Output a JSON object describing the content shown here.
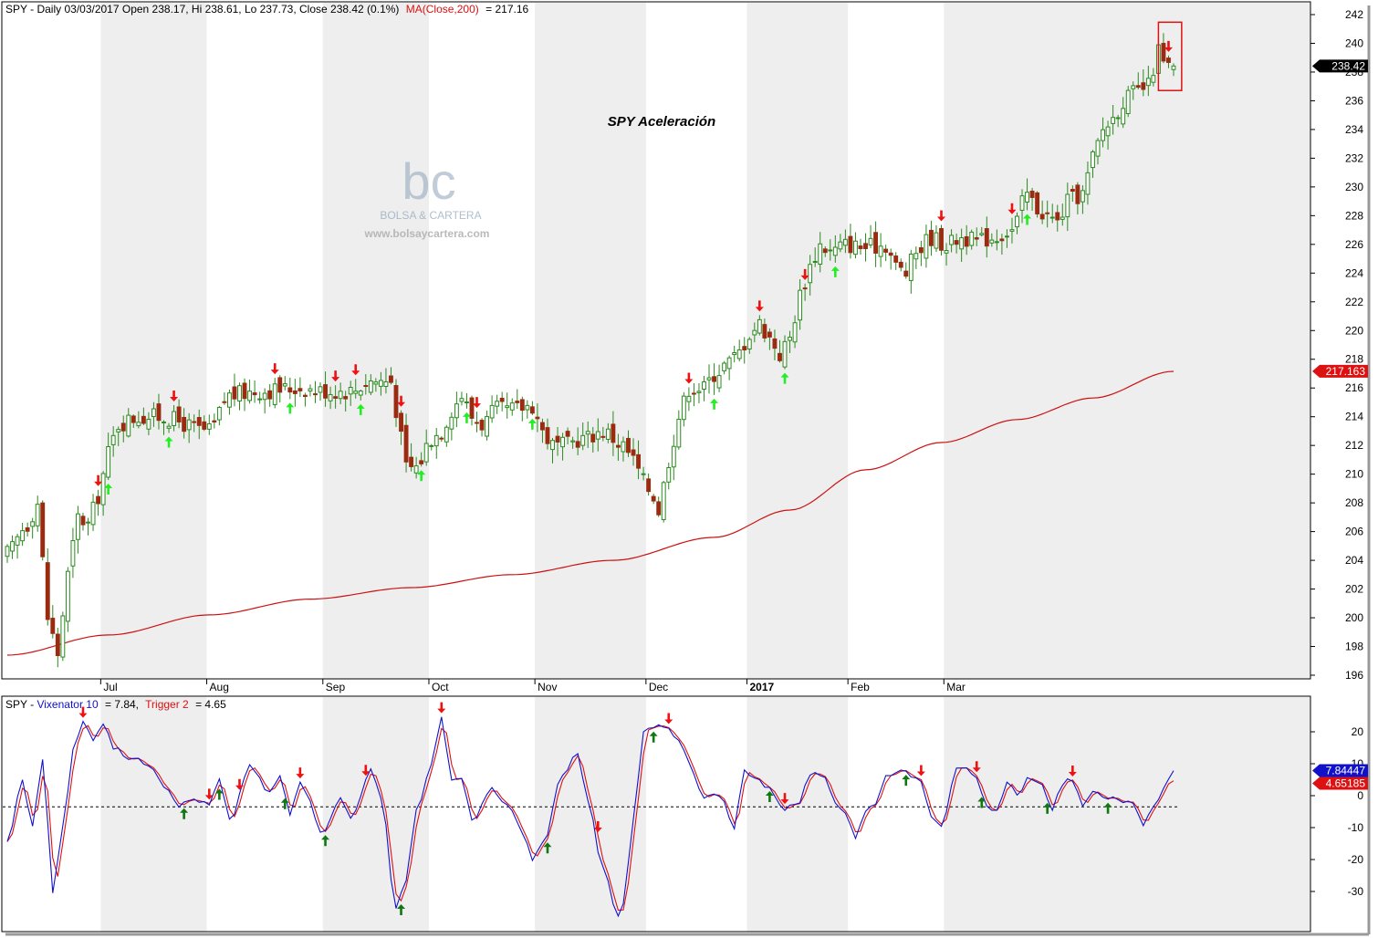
{
  "header": {
    "main_prefix": "SPY - Daily 03/03/2017 Open 238.17, Hi 238.61, Lo 237.73, Close 238.42 (0.1%)",
    "ma_label": "MA(Close,200)",
    "ma_value_text": "= 217.16",
    "ind_prefix": "SPY - ",
    "vix_label": "Vixenator 10",
    "vix_value_text": "= 7.84,",
    "trig_label": "Trigger 2",
    "trig_value_text": "= 4.65"
  },
  "annotation": "SPY Aceleración",
  "watermark": {
    "logo": "bc",
    "name": "BOLSA & CARTERA",
    "url": "www.bolsaycartera.com"
  },
  "colors": {
    "up": "#2a8a1e",
    "down": "#9a2a10",
    "ma": "#cc1111",
    "vix": "#1111cc",
    "trigger": "#dd1111",
    "arrow_up_main": "#22ee22",
    "arrow_up_ind": "#117711",
    "arrow_down": "#ee1111",
    "band": "#eeeeee"
  },
  "price_tags": [
    {
      "label": "238.42",
      "value": 238.42,
      "bg": "#000000",
      "fg": "#ffffff"
    },
    {
      "label": "217.163",
      "value": 217.163,
      "bg": "#dd1111",
      "fg": "#ffffff"
    }
  ],
  "ind_tags": [
    {
      "label": "7.84447",
      "value": 7.84,
      "bg": "#1111cc",
      "fg": "#ffffff"
    },
    {
      "label": "4.65185",
      "value": 4.65,
      "bg": "#dd1111",
      "fg": "#ffffff"
    }
  ],
  "chart_data": [
    {
      "type": "candlestick",
      "title": "SPY - Daily",
      "yticks": [
        196,
        198,
        200,
        202,
        204,
        206,
        208,
        210,
        212,
        214,
        216,
        218,
        220,
        222,
        224,
        226,
        228,
        230,
        232,
        234,
        236,
        238,
        240,
        242
      ],
      "ylim": [
        195,
        243
      ],
      "months": [
        {
          "label": "Jul",
          "bold": false
        },
        {
          "label": "Aug",
          "bold": false
        },
        {
          "label": "Sep",
          "bold": false
        },
        {
          "label": "Oct",
          "bold": false
        },
        {
          "label": "Nov",
          "bold": false
        },
        {
          "label": "Dec",
          "bold": false
        },
        {
          "label": "2017",
          "bold": true
        },
        {
          "label": "Feb",
          "bold": false
        },
        {
          "label": "Mar",
          "bold": false
        }
      ],
      "ma_anchors": [
        [
          0,
          197.4
        ],
        [
          20,
          198.8
        ],
        [
          40,
          200.2
        ],
        [
          60,
          201.3
        ],
        [
          80,
          202.1
        ],
        [
          100,
          203.0
        ],
        [
          120,
          204.0
        ],
        [
          140,
          205.6
        ],
        [
          155,
          207.5
        ],
        [
          170,
          210.3
        ],
        [
          185,
          212.2
        ],
        [
          200,
          213.8
        ],
        [
          215,
          215.3
        ],
        [
          231,
          217.16
        ]
      ],
      "close_anchors": [
        [
          0,
          204.5
        ],
        [
          4,
          206.5
        ],
        [
          6,
          208.0
        ],
        [
          8,
          200.0
        ],
        [
          10,
          197.5
        ],
        [
          12,
          203.0
        ],
        [
          14,
          207.0
        ],
        [
          16,
          206.5
        ],
        [
          18,
          208.5
        ],
        [
          20,
          211.5
        ],
        [
          22,
          213.5
        ],
        [
          26,
          214.0
        ],
        [
          30,
          214.0
        ],
        [
          40,
          213.0
        ],
        [
          44,
          215.5
        ],
        [
          50,
          215.8
        ],
        [
          58,
          216.0
        ],
        [
          62,
          215.8
        ],
        [
          68,
          215.8
        ],
        [
          72,
          216.5
        ],
        [
          76,
          216.5
        ],
        [
          77,
          214.5
        ],
        [
          79,
          210.5
        ],
        [
          81,
          210.5
        ],
        [
          84,
          212.5
        ],
        [
          86,
          213.0
        ],
        [
          88,
          214.5
        ],
        [
          90,
          215.5
        ],
        [
          92,
          214.0
        ],
        [
          94,
          213.5
        ],
        [
          97,
          214.5
        ],
        [
          100,
          214.5
        ],
        [
          104,
          214.8
        ],
        [
          106,
          213.0
        ],
        [
          108,
          212.0
        ],
        [
          110,
          212.0
        ],
        [
          114,
          212.5
        ],
        [
          118,
          213.0
        ],
        [
          122,
          212.0
        ],
        [
          124,
          211.0
        ],
        [
          126,
          209.5
        ],
        [
          128,
          208.5
        ],
        [
          129,
          207.5
        ],
        [
          131,
          211.0
        ],
        [
          133,
          214.0
        ],
        [
          135,
          216.0
        ],
        [
          138,
          216.0
        ],
        [
          140,
          217.0
        ],
        [
          143,
          217.8
        ],
        [
          145,
          218.5
        ],
        [
          147,
          219.8
        ],
        [
          149,
          220.5
        ],
        [
          150,
          220.0
        ],
        [
          152,
          219.0
        ],
        [
          153,
          218.3
        ],
        [
          155,
          219.5
        ],
        [
          157,
          222.5
        ],
        [
          159,
          224.5
        ],
        [
          161,
          226.0
        ],
        [
          163,
          225.5
        ],
        [
          166,
          226.0
        ],
        [
          170,
          225.8
        ],
        [
          174,
          226.0
        ],
        [
          176,
          224.5
        ],
        [
          178,
          224.0
        ],
        [
          180,
          225.5
        ],
        [
          183,
          226.5
        ],
        [
          186,
          226.0
        ],
        [
          189,
          226.5
        ],
        [
          192,
          226.2
        ],
        [
          195,
          226.5
        ],
        [
          199,
          227.0
        ],
        [
          202,
          229.5
        ],
        [
          204,
          228.5
        ],
        [
          206,
          228.0
        ],
        [
          208,
          227.5
        ],
        [
          210,
          229.0
        ],
        [
          213,
          229.5
        ],
        [
          215,
          232.0
        ],
        [
          217,
          234.0
        ],
        [
          219,
          234.8
        ],
        [
          221,
          236.0
        ],
        [
          223,
          236.5
        ],
        [
          226,
          237.0
        ],
        [
          228,
          239.5
        ],
        [
          229,
          238.5
        ],
        [
          230,
          238.4
        ],
        [
          231,
          238.42
        ]
      ],
      "down_arrow_idx": [
        18,
        33,
        53,
        65,
        69,
        78,
        93,
        135,
        149,
        158,
        185,
        199,
        230
      ],
      "up_arrow_idx": [
        20,
        32,
        56,
        70,
        82,
        91,
        104,
        140,
        154,
        164,
        202
      ],
      "n_bars": 232,
      "current": {
        "open": 238.17,
        "high": 238.61,
        "low": 237.73,
        "close": 238.42
      },
      "ma200_last": 217.16,
      "highlight_box_last_bars": 3
    },
    {
      "type": "line",
      "title": "Vixenator 10 / Trigger 2",
      "yticks": [
        -30,
        -20,
        -10,
        0,
        10,
        20
      ],
      "ylim": [
        -38,
        27
      ],
      "dashed_level": -3.5,
      "series": [
        {
          "name": "Vixenator 10",
          "last": 7.84
        },
        {
          "name": "Trigger 2",
          "last": 4.65
        }
      ],
      "vix_anchors": [
        [
          0,
          -15
        ],
        [
          3,
          5
        ],
        [
          5,
          -10
        ],
        [
          7,
          12
        ],
        [
          9,
          -30
        ],
        [
          11,
          -10
        ],
        [
          13,
          14
        ],
        [
          15,
          23
        ],
        [
          17,
          18
        ],
        [
          19,
          23
        ],
        [
          21,
          15
        ],
        [
          24,
          12
        ],
        [
          28,
          10
        ],
        [
          32,
          2
        ],
        [
          34,
          -3
        ],
        [
          37,
          -1
        ],
        [
          40,
          -3
        ],
        [
          42,
          5
        ],
        [
          44,
          -8
        ],
        [
          48,
          9
        ],
        [
          52,
          1
        ],
        [
          54,
          6
        ],
        [
          56,
          -6
        ],
        [
          58,
          5
        ],
        [
          60,
          -1
        ],
        [
          62,
          -12
        ],
        [
          66,
          -1
        ],
        [
          68,
          -7
        ],
        [
          72,
          8
        ],
        [
          74,
          -1
        ],
        [
          77,
          -35
        ],
        [
          79,
          -26
        ],
        [
          81,
          -5
        ],
        [
          84,
          10
        ],
        [
          86,
          24
        ],
        [
          88,
          5
        ],
        [
          90,
          5
        ],
        [
          92,
          -8
        ],
        [
          96,
          2
        ],
        [
          99,
          -3
        ],
        [
          102,
          -11
        ],
        [
          104,
          -20
        ],
        [
          106,
          -15
        ],
        [
          110,
          6
        ],
        [
          113,
          13
        ],
        [
          115,
          -1
        ],
        [
          118,
          -23
        ],
        [
          121,
          -38
        ],
        [
          122,
          -34
        ],
        [
          124,
          -8
        ],
        [
          126,
          20
        ],
        [
          128,
          21
        ],
        [
          130,
          22
        ],
        [
          133,
          18
        ],
        [
          135,
          10
        ],
        [
          138,
          0
        ],
        [
          141,
          0
        ],
        [
          144,
          -10
        ],
        [
          146,
          8
        ],
        [
          148,
          6
        ],
        [
          151,
          2
        ],
        [
          154,
          -4
        ],
        [
          157,
          -2
        ],
        [
          159,
          7
        ],
        [
          162,
          5
        ],
        [
          164,
          -2
        ],
        [
          166,
          -5
        ],
        [
          168,
          -13
        ],
        [
          170,
          -5
        ],
        [
          172,
          -2
        ],
        [
          174,
          6
        ],
        [
          176,
          8
        ],
        [
          178,
          7
        ],
        [
          181,
          5
        ],
        [
          183,
          -6
        ],
        [
          185,
          -9
        ],
        [
          188,
          8
        ],
        [
          190,
          8
        ],
        [
          192,
          5
        ],
        [
          194,
          -4
        ],
        [
          196,
          -5
        ],
        [
          198,
          5
        ],
        [
          200,
          0
        ],
        [
          202,
          5
        ],
        [
          205,
          3
        ],
        [
          207,
          -4
        ],
        [
          209,
          4
        ],
        [
          211,
          5
        ],
        [
          213,
          -4
        ],
        [
          215,
          2
        ],
        [
          217,
          0
        ],
        [
          219,
          -1
        ],
        [
          221,
          -2
        ],
        [
          223,
          -2
        ],
        [
          225,
          -9
        ],
        [
          227,
          -3
        ],
        [
          229,
          2
        ],
        [
          231,
          7.84
        ]
      ],
      "down_arrow_idx": [
        15,
        40,
        46,
        58,
        71,
        86,
        117,
        131,
        154,
        181,
        192,
        211
      ],
      "up_arrow_idx": [
        35,
        42,
        55,
        63,
        78,
        107,
        128,
        151,
        178,
        193,
        206,
        218
      ]
    }
  ]
}
